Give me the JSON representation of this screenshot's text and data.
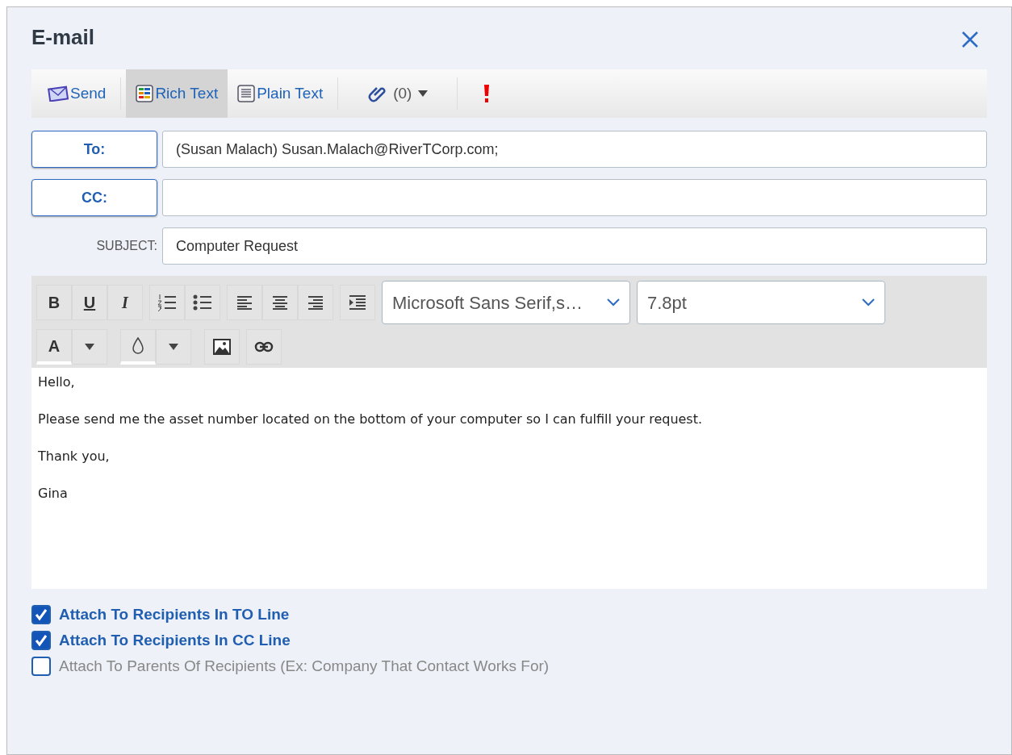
{
  "window": {
    "title": "E-mail"
  },
  "toolbar": [
    {
      "kind": "send",
      "label": "Send",
      "selected": false
    },
    {
      "kind": "rich",
      "label": "Rich Text",
      "selected": true
    },
    {
      "kind": "plain",
      "label": "Plain Text",
      "selected": false
    },
    {
      "kind": "attach",
      "label": "(0)",
      "selected": false
    },
    {
      "kind": "priority",
      "selected": false
    }
  ],
  "to": {
    "label": "To:",
    "value": "(Susan Malach) Susan.Malach@RiverTCorp.com;"
  },
  "cc": {
    "label": "CC:"
  },
  "subject": {
    "label": "SUBJECT:",
    "value": "Computer Request"
  },
  "format_buttons": [
    {
      "kind": "bold",
      "label": "B"
    },
    {
      "kind": "underline",
      "label": "U"
    },
    {
      "kind": "italic",
      "label": "I"
    }
  ],
  "font_color": {
    "label": "A"
  },
  "font": {
    "value": "Microsoft Sans Serif,s…"
  },
  "size": {
    "value": "7.8pt"
  },
  "body": [
    "Hello,",
    "Please send me the asset number located on the bottom of your computer so I can fulfill your request.",
    "Thank you,",
    "Gina"
  ],
  "options": [
    {
      "label": "Attach To Recipients In TO Line",
      "checked": true
    },
    {
      "label": "Attach To Recipients In CC Line",
      "checked": true
    },
    {
      "label": "Attach To Parents Of Recipients (Ex: Company That Contact Works For)",
      "checked": false
    }
  ]
}
